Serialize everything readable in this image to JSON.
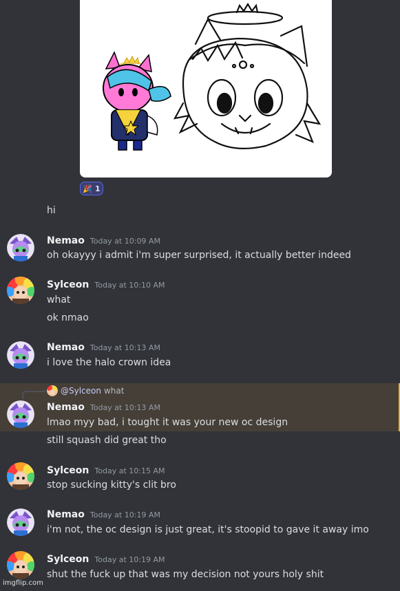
{
  "reaction": {
    "emoji": "🎉",
    "count": "1"
  },
  "messages": [
    {
      "continuation": true,
      "text": "hi"
    },
    {
      "author": "Nemao",
      "timestamp": "Today at 10:09 AM",
      "lines": [
        "oh okayyy i admit i'm super surprised, it actually better indeed"
      ]
    },
    {
      "author": "Sylceon",
      "timestamp": "Today at 10:10 AM",
      "lines": [
        "what",
        "ok nmao"
      ]
    },
    {
      "author": "Nemao",
      "timestamp": "Today at 10:13 AM",
      "lines": [
        "i love the halo crown idea"
      ]
    },
    {
      "author": "Nemao",
      "timestamp": "Today at 10:13 AM",
      "reply_to": "@Sylceon",
      "reply_text": "what",
      "lines": [
        "lmao myy bad, i tought it was your new oc design",
        "still squash did great tho"
      ]
    },
    {
      "author": "Sylceon",
      "timestamp": "Today at 10:15 AM",
      "lines": [
        "stop sucking kitty's clit bro"
      ]
    },
    {
      "author": "Nemao",
      "timestamp": "Today at 10:19 AM",
      "lines": [
        "i'm not, the oc design is just great, it's stoopid to gave it away imo"
      ]
    },
    {
      "author": "Sylceon",
      "timestamp": "Today at 10:19 AM",
      "lines": [
        "shut the fuck up that was my decision not yours holy shit"
      ]
    }
  ],
  "watermark": "imgflip.com",
  "colors": {
    "background": "#313338",
    "mention_highlight": "#463f38",
    "mention_bar": "#f0b232",
    "reaction_bg": "#3b3f6e",
    "reaction_border": "#5865f2"
  }
}
